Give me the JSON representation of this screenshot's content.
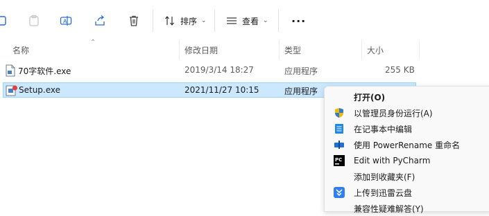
{
  "toolbar": {
    "sort_label": "排序",
    "view_label": "查看",
    "more_label": "···"
  },
  "columns": {
    "name": "名称",
    "modified": "修改日期",
    "type": "类型",
    "size": "大小"
  },
  "files": [
    {
      "name": "70字软件.exe",
      "modified": "2019/3/14 18:27",
      "type": "应用程序",
      "size": "255 KB",
      "selected": false
    },
    {
      "name": "Setup.exe",
      "modified": "2021/11/27 10:15",
      "type": "应用程序",
      "size": "",
      "selected": true
    }
  ],
  "context_menu": {
    "items": [
      {
        "label": "打开(O)",
        "icon": "none",
        "bold": true
      },
      {
        "label": "以管理员身份运行(A)",
        "icon": "uac-shield-icon"
      },
      {
        "label": "在记事本中编辑",
        "icon": "notepad-icon"
      },
      {
        "label": "使用 PowerRename 重命名",
        "icon": "powerrename-icon"
      },
      {
        "label": "Edit with PyCharm",
        "icon": "pycharm-icon"
      },
      {
        "label": "添加到收藏夹(F)",
        "icon": "none"
      },
      {
        "label": "上传到迅雷云盘",
        "icon": "xunlei-icon"
      },
      {
        "label": "兼容性疑难解答(Y)",
        "icon": "none"
      }
    ]
  },
  "colors": {
    "selection_bg": "#cce8ff",
    "selection_border": "#99d1ff",
    "menu_bg": "#f9f9f9"
  }
}
